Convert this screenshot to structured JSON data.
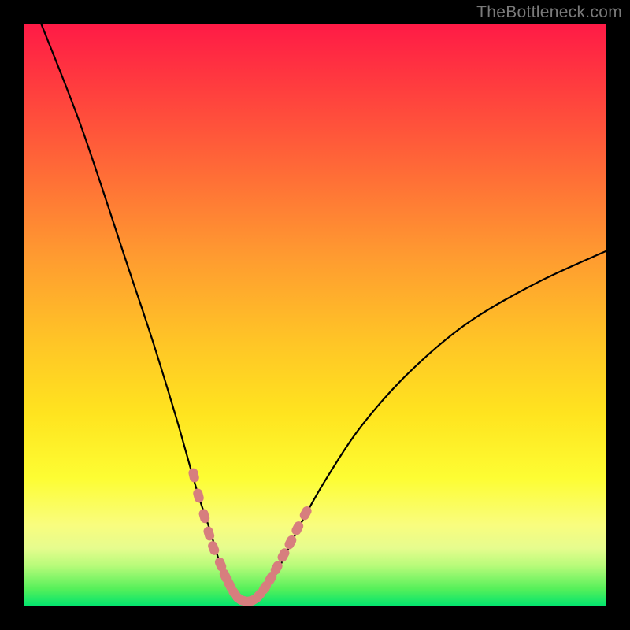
{
  "watermark": "TheBottleneck.com",
  "colors": {
    "background": "#000000",
    "gradient_top": "#ff1a46",
    "gradient_mid1": "#ff9b30",
    "gradient_mid2": "#ffe41f",
    "gradient_bottom": "#00e46e",
    "curve": "#000000",
    "marker": "#d77e7e"
  },
  "chart_data": {
    "type": "line",
    "title": "",
    "xlabel": "",
    "ylabel": "",
    "xlim": [
      0,
      100
    ],
    "ylim": [
      0,
      100
    ],
    "grid": false,
    "series": [
      {
        "name": "bottleneck-curve",
        "x": [
          3,
          10,
          18,
          22,
          26,
          28,
          30,
          32,
          33.5,
          35,
          36.5,
          38,
          39.5,
          41,
          43,
          45,
          48,
          52,
          58,
          66,
          76,
          88,
          100
        ],
        "y": [
          100,
          82,
          58,
          46,
          33,
          26,
          19,
          13,
          8,
          4.5,
          2,
          0.8,
          0.8,
          2,
          5,
          9,
          15,
          22,
          31,
          40,
          48.5,
          55.5,
          61
        ]
      }
    ],
    "markers": {
      "name": "highlight-dots",
      "color": "#d77e7e",
      "x": [
        29.2,
        30.0,
        31.0,
        31.8,
        32.6,
        33.8,
        34.6,
        35.4,
        36.2,
        37.0,
        38.0,
        38.8,
        39.6,
        40.4,
        41.4,
        42.4,
        43.4,
        44.6,
        45.8,
        47.0,
        48.4
      ],
      "y": [
        22.5,
        19.0,
        15.5,
        12.5,
        10.0,
        7.2,
        5.2,
        3.6,
        2.2,
        1.3,
        0.9,
        0.9,
        1.2,
        1.9,
        3.2,
        4.8,
        6.6,
        8.8,
        11.0,
        13.4,
        16.0
      ]
    }
  }
}
